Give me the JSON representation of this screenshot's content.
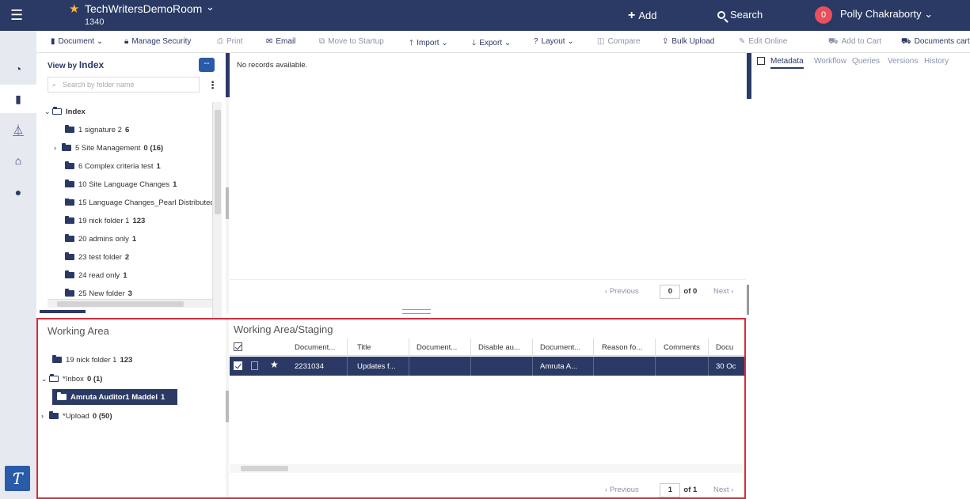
{
  "header": {
    "room_name": "TechWritersDemoRoom",
    "room_id": "1340",
    "add_label": "Add",
    "search_label": "Search",
    "notification_count": "0",
    "user_name": "Polly Chakraborty"
  },
  "toolbar": {
    "document": "Document",
    "manage_security": "Manage Security",
    "print": "Print",
    "email": "Email",
    "move_to_startup": "Move to Startup",
    "import": "Import",
    "export": "Export",
    "layout": "Layout",
    "compare": "Compare",
    "bulk_upload": "Bulk Upload",
    "edit_online": "Edit Online",
    "add_to_cart": "Add to Cart",
    "documents_cart": "Documents cart"
  },
  "tree": {
    "view_by_prefix": "View by",
    "view_by_value": "Index",
    "collapse_label": "--",
    "search_placeholder": "Search by folder name",
    "root": "Index",
    "items": [
      {
        "name": "1 signature 2",
        "count": "6"
      },
      {
        "name": "5 Site Management",
        "count": "0 (16)"
      },
      {
        "name": "6 Complex criteria test",
        "count": "1"
      },
      {
        "name": "10 Site Language Changes",
        "count": "1"
      },
      {
        "name": "15 Language Changes_Pearl Distributed",
        "count": ""
      },
      {
        "name": "19 nick folder 1",
        "count": "123"
      },
      {
        "name": "20 admins only",
        "count": "1"
      },
      {
        "name": "23 test folder",
        "count": "2"
      },
      {
        "name": "24 read only",
        "count": "1"
      },
      {
        "name": "25 New folder",
        "count": "3"
      }
    ]
  },
  "main": {
    "no_records": "No records available.",
    "pager": {
      "previous": "Previous",
      "page": "0",
      "of": "of 0",
      "next": "Next"
    }
  },
  "right_panel": {
    "tabs": [
      "Metadata",
      "Workflow",
      "Queries",
      "Versions",
      "History"
    ]
  },
  "working_area": {
    "title": "Working Area",
    "items": [
      {
        "name": "19 nick folder 1",
        "count": "123"
      },
      {
        "name": "*Inbox",
        "count": "0 (1)"
      },
      {
        "name": "Amruta Auditor1 Maddel",
        "count": "1"
      },
      {
        "name": "*Upload",
        "count": "0 (50)"
      }
    ]
  },
  "staging": {
    "title": "Working Area/Staging",
    "columns": [
      "Document...",
      "Title",
      "Document...",
      "Disable au...",
      "Document...",
      "Reason fo...",
      "Comments",
      "Docu"
    ],
    "row": {
      "doc_number": "2231034",
      "title": "Updates f...",
      "doc3": "",
      "disable": "",
      "document": "Amruta A...",
      "reason": "",
      "comments": "",
      "date": "30 Oc"
    },
    "pager": {
      "previous": "Previous",
      "page": "1",
      "of": "of 1",
      "next": "Next"
    }
  }
}
